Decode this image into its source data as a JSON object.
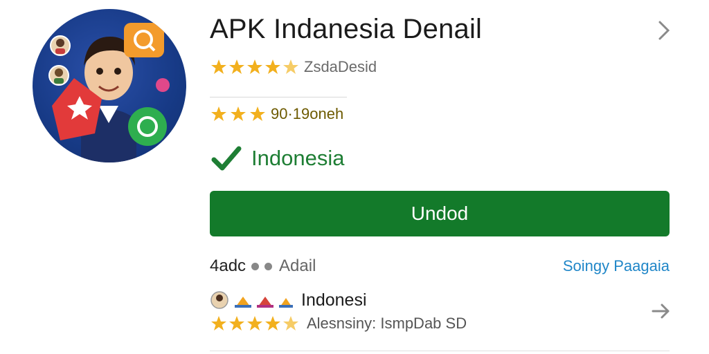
{
  "app": {
    "title": "APK Indanesia Denail",
    "rating_label": "ZsdaDesid",
    "rating_stars": 4.5,
    "secondary_rating_label": "90·19oneh",
    "secondary_rating_stars": 3,
    "verified_label": "Indonesia",
    "action_button": "Undod",
    "meta_count": "4adc",
    "meta_detail": "Adail",
    "meta_link": "Soingy Paagaia",
    "developer_name": "Indonesi",
    "developer_rating_label": "Alesnsiny: IsmpDab SD",
    "developer_rating_stars": 4
  },
  "colors": {
    "accent_green": "#137a2a",
    "verified_green": "#1e7e34",
    "star": "#f2b01e",
    "link_blue": "#1f86c8",
    "icon_bg": "#173a86"
  },
  "icons": {
    "top_chevron": "chevron-right-icon",
    "bottom_chevron": "chevron-right-icon",
    "verified": "check-icon",
    "search": "search-icon",
    "chat": "chat-icon"
  }
}
